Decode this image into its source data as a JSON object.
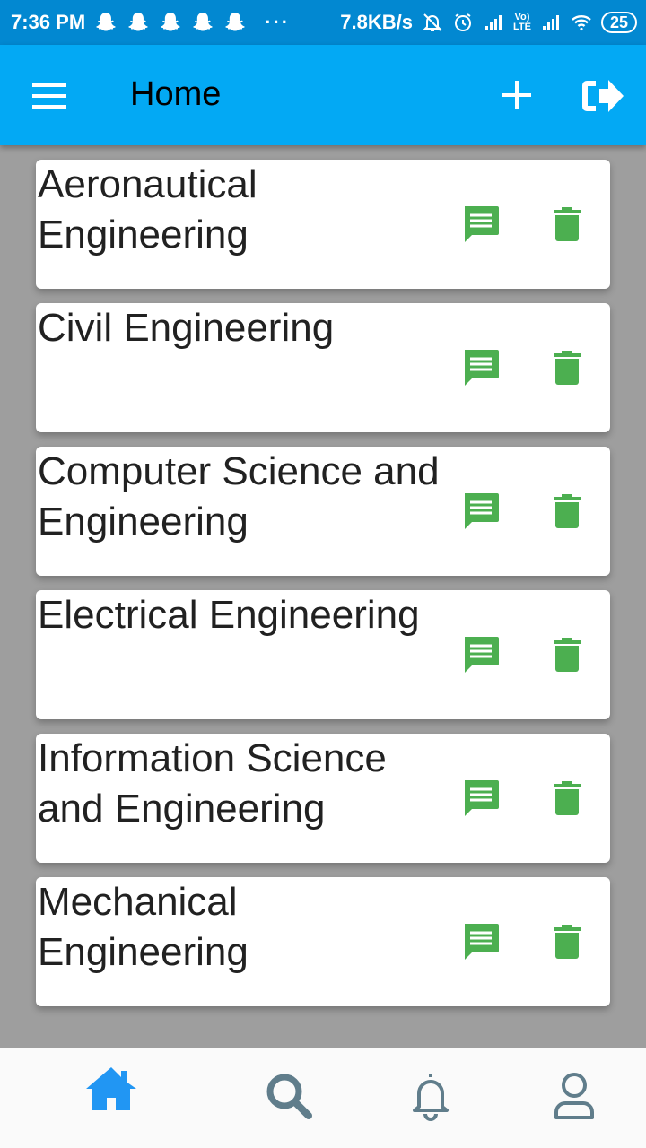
{
  "status_bar": {
    "time": "7:36 PM",
    "dots": "···",
    "speed": "7.8KB/s",
    "lte_top": "Vo)",
    "lte_bottom": "LTE",
    "battery": "25",
    "icons": [
      "snapchat-icon",
      "snapchat-icon",
      "snapchat-icon",
      "snapchat-icon",
      "snapchat-icon",
      "mute-icon",
      "alarm-icon",
      "signal-icon",
      "signal-icon",
      "wifi-icon",
      "battery-icon"
    ]
  },
  "app_bar": {
    "title": "Home",
    "icons": [
      "menu-icon",
      "add-icon",
      "logout-icon"
    ]
  },
  "branches": [
    {
      "name": "Aeronautical Engineering"
    },
    {
      "name": "Civil Engineering"
    },
    {
      "name": "Computer Science and Engineering"
    },
    {
      "name": "Electrical Engineering"
    },
    {
      "name": "Information Science and Engineering"
    },
    {
      "name": "Mechanical Engineering"
    }
  ],
  "card_icons": [
    "chat-icon",
    "trash-icon"
  ],
  "bottom_nav": {
    "items": [
      "home-icon",
      "search-icon",
      "bell-icon",
      "profile-icon"
    ],
    "active": "home-icon"
  },
  "colors": {
    "status_bar": "#0288d1",
    "app_bar": "#03a9f4",
    "action_green": "#4caf50",
    "active_nav": "#2196f3",
    "inactive_nav": "#607d8b",
    "background": "#9e9e9e"
  }
}
